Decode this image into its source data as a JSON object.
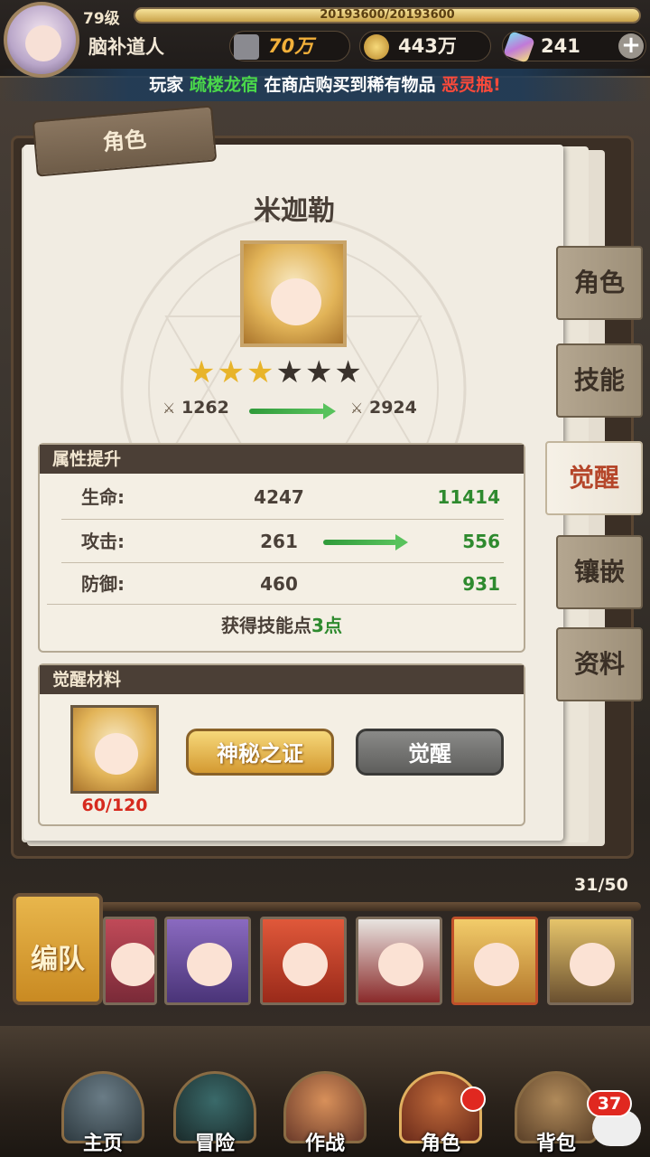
{
  "player": {
    "level": "79级",
    "exp": "20193600/20193600",
    "exp_fraction": 1.0,
    "name": "脑补道人",
    "power": "70万",
    "gold": "443万",
    "gems": "241"
  },
  "notice": {
    "prefix": "玩家 ",
    "player": "疏楼龙宿",
    "middle": " 在商店购买到稀有物品 ",
    "item": "恶灵瓶!"
  },
  "tag_label": "角色",
  "character": {
    "name": "米迦勒",
    "stars_filled": 3,
    "stars_total": 6,
    "power_before": "1262",
    "power_after": "2924"
  },
  "attributes": {
    "title": "属性提升",
    "rows": [
      {
        "label": "生命:",
        "before": "4247",
        "after": "11414"
      },
      {
        "label": "攻击:",
        "before": "261",
        "after": "556"
      },
      {
        "label": "防御:",
        "before": "460",
        "after": "931"
      }
    ],
    "skill_text": "获得技能点",
    "skill_value": "3点"
  },
  "materials": {
    "title": "觉醒材料",
    "count": "60/120",
    "mystery_button": "神秘之证",
    "awaken_button": "觉醒"
  },
  "side_tabs": [
    {
      "label": "角色",
      "active": false
    },
    {
      "label": "技能",
      "active": false
    },
    {
      "label": "觉醒",
      "active": true
    },
    {
      "label": "镶嵌",
      "active": false
    },
    {
      "label": "资料",
      "active": false
    }
  ],
  "roster": {
    "count": "31/50",
    "team_button": "编队"
  },
  "nav": [
    {
      "label": "主页"
    },
    {
      "label": "冒险"
    },
    {
      "label": "作战"
    },
    {
      "label": "角色"
    },
    {
      "label": "背包"
    }
  ],
  "chat_badge": "37",
  "colors": {
    "accent_green": "#2e8a2e",
    "accent_red": "#d62a1e",
    "tab_active": "#b5462a"
  }
}
